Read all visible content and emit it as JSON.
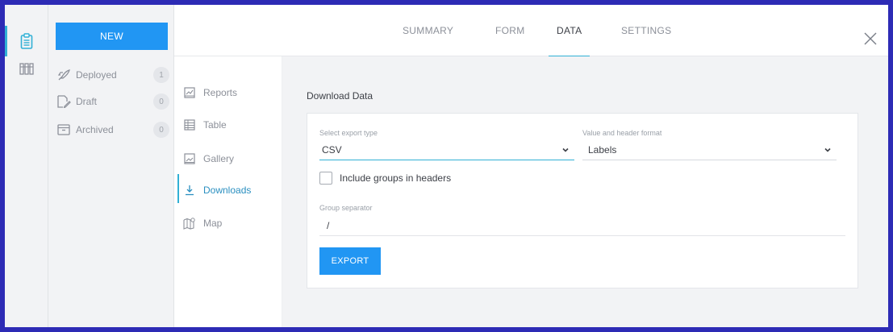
{
  "rail": {
    "icons": [
      "clipboard-icon",
      "library-icon"
    ],
    "accent": "#31b0d5"
  },
  "projects": {
    "new_label": "NEW",
    "items": [
      {
        "label": "Deployed",
        "count": "1",
        "icon": "rocket-icon"
      },
      {
        "label": "Draft",
        "count": "0",
        "icon": "draft-icon"
      },
      {
        "label": "Archived",
        "count": "0",
        "icon": "archive-icon"
      }
    ]
  },
  "tabs": {
    "summary": "SUMMARY",
    "form": "FORM",
    "data": "DATA",
    "settings": "SETTINGS",
    "active": "DATA"
  },
  "subnav": {
    "items": [
      {
        "label": "Reports",
        "icon": "reports-icon"
      },
      {
        "label": "Table",
        "icon": "table-icon"
      },
      {
        "label": "Gallery",
        "icon": "gallery-icon"
      },
      {
        "label": "Downloads",
        "icon": "download-icon"
      },
      {
        "label": "Map",
        "icon": "map-icon"
      }
    ],
    "active": "Downloads"
  },
  "download": {
    "title": "Download Data",
    "export_type_label": "Select export type",
    "export_type_value": "CSV",
    "format_label": "Value and header format",
    "format_value": "Labels",
    "include_groups_label": "Include groups in headers",
    "include_groups_checked": false,
    "separator_label": "Group separator",
    "separator_value": "/",
    "export_label": "EXPORT"
  },
  "colors": {
    "primary": "#2196f3",
    "frame": "#2d2bb5",
    "active_accent": "#31b0d5"
  }
}
